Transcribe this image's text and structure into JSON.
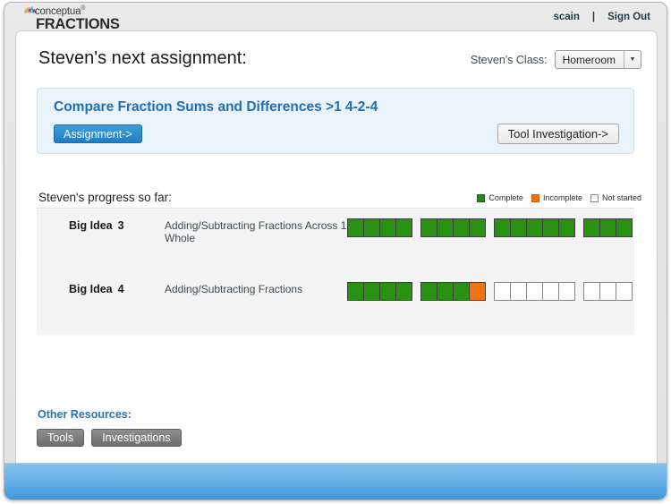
{
  "app": {
    "brand_name": "conceptua",
    "brand_registered": "®",
    "brand_product": "FRACTIONS",
    "accent_blue": "#1f6fb5",
    "footer_blue": "#62aee5"
  },
  "account": {
    "user": "scain",
    "separator": "|",
    "sign_out": "Sign Out"
  },
  "header": {
    "title": "Steven's next assignment:",
    "class_label": "Steven's Class:",
    "class_selected": "Homeroom",
    "class_options": [
      "Homeroom"
    ],
    "dropdown_glyph": "▼"
  },
  "assignment": {
    "title": "Compare Fraction Sums and Differences >1  4-2-4",
    "primary_button": "Assignment->",
    "secondary_button": "Tool Investigation->"
  },
  "progress": {
    "heading": "Steven's progress so far:",
    "legend": [
      {
        "label": "Complete",
        "state": "complete",
        "color": "#1f8a1f"
      },
      {
        "label": "Incomplete",
        "state": "incomplete",
        "color": "#ef7312"
      },
      {
        "label": "Not started",
        "state": "notstarted",
        "color": "#ffffff"
      }
    ],
    "rows": [
      {
        "name": "Big Idea",
        "number": "3",
        "description": "Adding/Subtracting Fractions Across 1 Whole",
        "groups": [
          [
            "complete",
            "complete",
            "complete",
            "complete"
          ],
          [
            "complete",
            "complete",
            "complete",
            "complete"
          ],
          [
            "complete",
            "complete",
            "complete",
            "complete",
            "complete"
          ],
          [
            "complete",
            "complete",
            "complete"
          ]
        ]
      },
      {
        "name": "Big Idea",
        "number": "4",
        "description": "Adding/Subtracting Fractions",
        "groups": [
          [
            "complete",
            "complete",
            "complete",
            "complete"
          ],
          [
            "complete",
            "complete",
            "complete",
            "incomplete"
          ],
          [
            "notstarted",
            "notstarted",
            "notstarted",
            "notstarted",
            "notstarted"
          ],
          [
            "notstarted",
            "notstarted",
            "notstarted"
          ]
        ]
      }
    ]
  },
  "resources": {
    "title": "Other Resources:",
    "buttons": [
      "Tools",
      "Investigations"
    ]
  }
}
